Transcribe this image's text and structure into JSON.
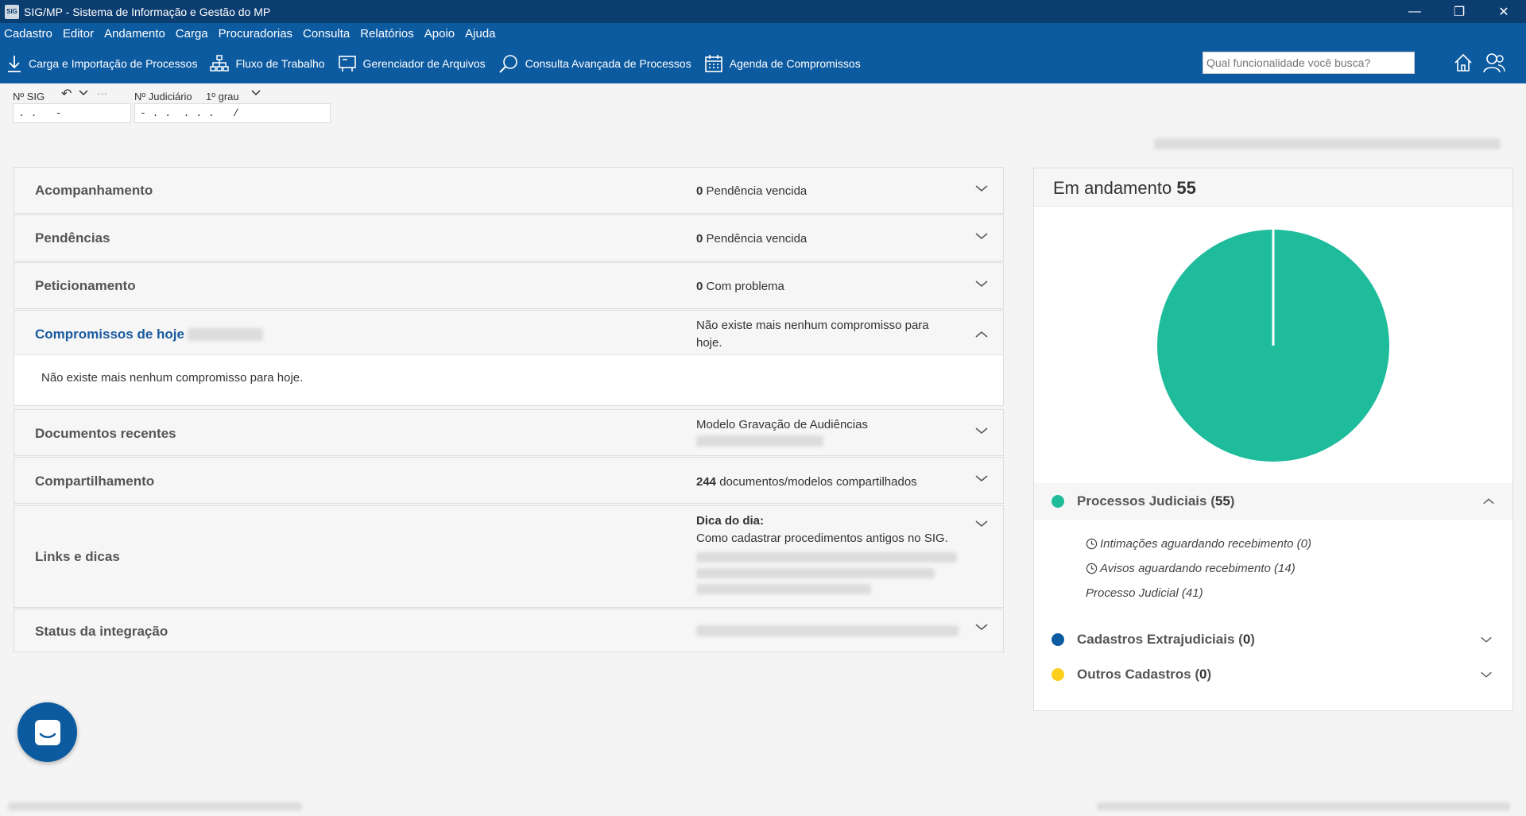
{
  "window": {
    "title": "SIG/MP - Sistema de Informação e Gestão do MP",
    "app_icon_text": "SIG"
  },
  "menu": [
    "Cadastro",
    "Editor",
    "Andamento",
    "Carga",
    "Procuradorias",
    "Consulta",
    "Relatórios",
    "Apoio",
    "Ajuda"
  ],
  "toolbar": {
    "items": [
      {
        "label": "Carga e Importação de Processos",
        "icon": "download-icon"
      },
      {
        "label": "Fluxo de Trabalho",
        "icon": "workflow-icon"
      },
      {
        "label": "Gerenciador de Arquivos",
        "icon": "file-manager-icon"
      },
      {
        "label": "Consulta Avançada de Processos",
        "icon": "advanced-search-icon"
      },
      {
        "label": "Agenda de Compromissos",
        "icon": "calendar-icon"
      }
    ],
    "search_placeholder": "Qual funcionalidade você busca?"
  },
  "search": {
    "sig_label": "Nº SIG",
    "sig_value": ". .   -",
    "judicial_label": "Nº Judiciário",
    "degree": "1º grau",
    "judicial_value": "- . .  . . .   /"
  },
  "panels": [
    {
      "title": "Acompanhamento",
      "count": "0",
      "status": "Pendência vencida"
    },
    {
      "title": "Pendências",
      "count": "0",
      "status": "Pendência vencida"
    },
    {
      "title": "Peticionamento",
      "count": "0",
      "status": "Com problema"
    },
    {
      "title": "Compromissos de hoje",
      "status": "Não existe mais nenhum compromisso para hoje.",
      "body": "Não existe mais nenhum compromisso para hoje."
    },
    {
      "title": "Documentos recentes",
      "status": "Modelo Gravação de Audiências"
    },
    {
      "title": "Compartilhamento",
      "count": "244",
      "status": "documentos/modelos compartilhados"
    },
    {
      "title": "Links e dicas",
      "tip_title": "Dica do dia:",
      "status": "Como cadastrar procedimentos antigos no SIG."
    },
    {
      "title": "Status da integração"
    }
  ],
  "summary": {
    "title": "Em andamento",
    "total": "55",
    "groups": [
      {
        "label": "Processos Judiciais",
        "count": "55",
        "color": "#1fbc9c"
      },
      {
        "label": "Cadastros Extrajudiciais",
        "count": "0",
        "color": "#0c5aa0"
      },
      {
        "label": "Outros Cadastros",
        "count": "0",
        "color": "#fccf1c"
      }
    ],
    "details": [
      "Intimações aguardando recebimento (0)",
      "Avisos aguardando recebimento (14)",
      "Processo Judicial (41)"
    ]
  },
  "chart_data": {
    "type": "pie",
    "categories": [
      "Processos Judiciais",
      "Cadastros Extrajudiciais",
      "Outros Cadastros"
    ],
    "values": [
      55,
      0,
      0
    ],
    "colors": [
      "#1fbc9c",
      "#0c5aa0",
      "#fccf1c"
    ]
  }
}
